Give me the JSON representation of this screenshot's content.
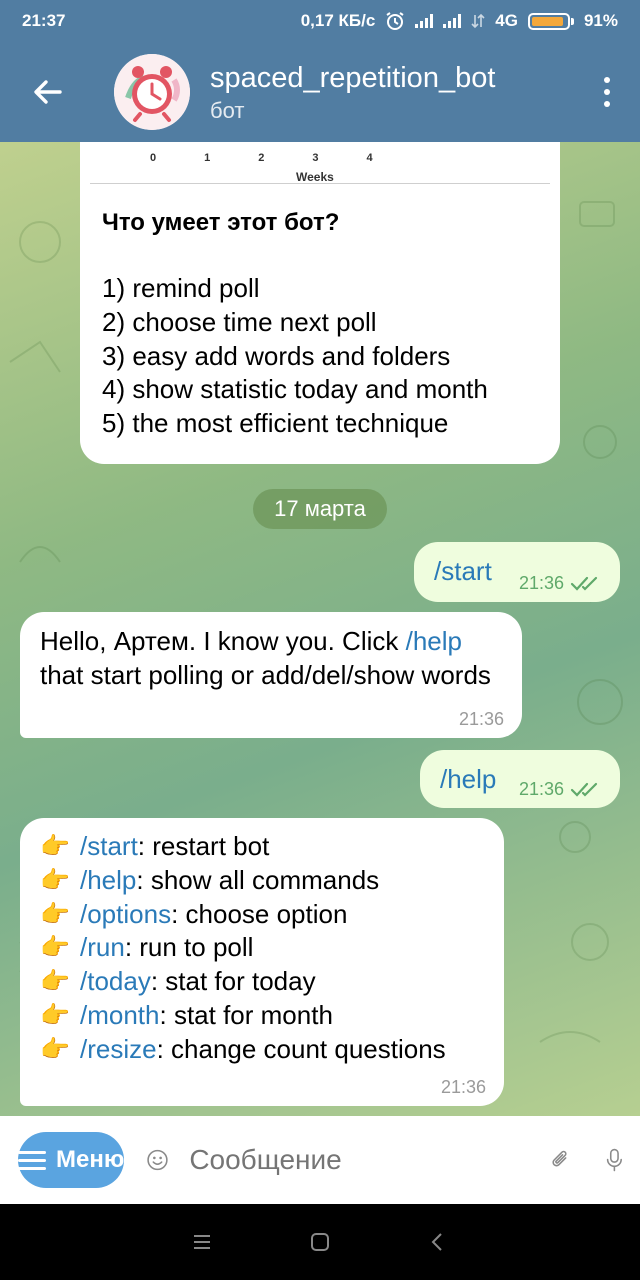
{
  "status_bar": {
    "time": "21:37",
    "speed": "0,17 КБ/с",
    "network": "4G",
    "battery_percent": "91%",
    "battery_level": 0.91,
    "icons": [
      "alarm-icon",
      "signal-icon",
      "signal-icon",
      "data-icon",
      "battery-icon"
    ]
  },
  "header": {
    "title": "spaced_repetition_bot",
    "subtitle": "бот",
    "back_icon": "arrow-left-icon",
    "more_icon": "more-vertical-icon"
  },
  "intro": {
    "graph_ticks": [
      "0",
      "1",
      "2",
      "3",
      "4"
    ],
    "graph_xlabel": "Weeks",
    "heading": "Что умеет этот бот?",
    "items": [
      "1) remind poll",
      "2) choose time next poll",
      "3) easy add words and folders",
      "4) show statistic today and month",
      "5) the most efficient technique"
    ]
  },
  "date_separator": "17 марта",
  "messages": [
    {
      "dir": "out",
      "text": "/start",
      "time": "21:36"
    },
    {
      "dir": "in",
      "text_pre": "Hello, Артем. I know you. Click ",
      "link": "/help",
      "text_post": " that start polling or add/del/show words",
      "time": "21:36"
    },
    {
      "dir": "out",
      "text": "/help",
      "time": "21:36"
    },
    {
      "dir": "in",
      "time": "21:36",
      "bullet": "👉",
      "commands": [
        {
          "cmd": "/start",
          "desc": ": restart bot"
        },
        {
          "cmd": "/help",
          "desc": ": show all commands"
        },
        {
          "cmd": "/options",
          "desc": ": choose option"
        },
        {
          "cmd": "/run",
          "desc": ": run to poll"
        },
        {
          "cmd": "/today",
          "desc": ": stat for today"
        },
        {
          "cmd": "/month",
          "desc": ": stat for month"
        },
        {
          "cmd": "/resize",
          "desc": ": change count questions"
        }
      ]
    }
  ],
  "input_bar": {
    "menu_label": "Меню",
    "placeholder": "Сообщение",
    "icons": [
      "emoji-icon",
      "attach-icon",
      "mic-icon"
    ]
  },
  "nav_bar": {
    "icons": [
      "recents-icon",
      "home-icon",
      "back-icon"
    ]
  },
  "colors": {
    "header": "#517da2",
    "link": "#2a7ab8",
    "outgoing_bubble": "#effdde",
    "menu_button": "#5aa4e0",
    "battery": "#f4a83a"
  }
}
